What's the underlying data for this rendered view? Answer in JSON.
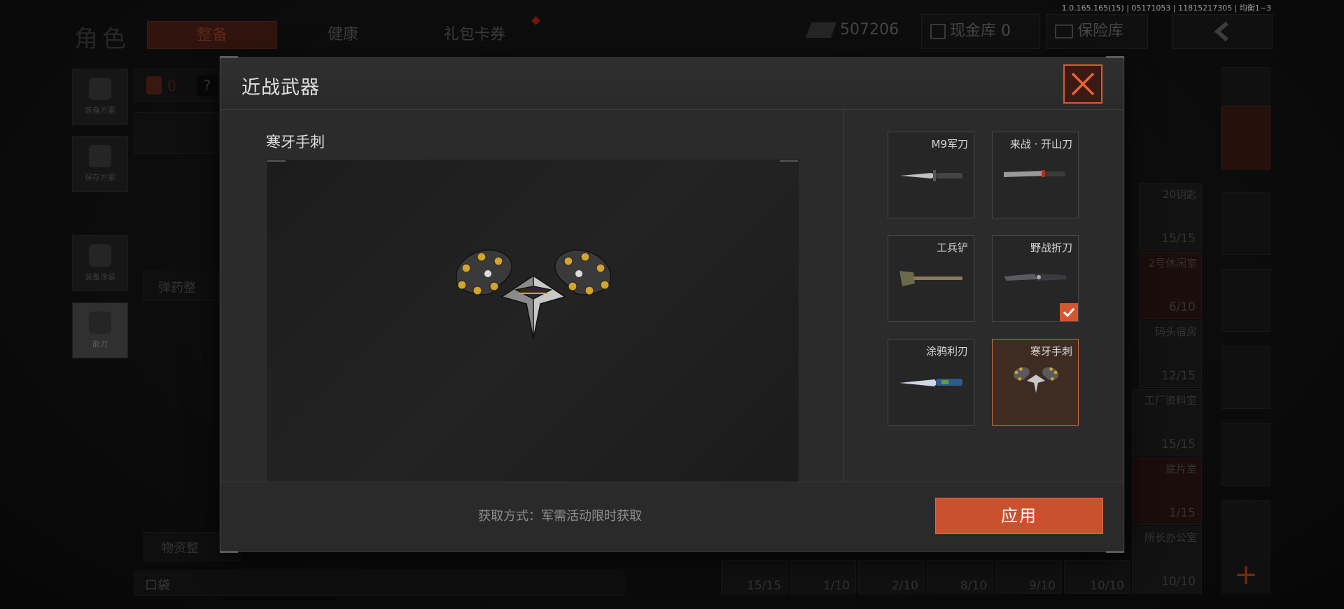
{
  "version": "1.0.165.165(15) | 05171053 | 11815217305 | 均衡1~3",
  "background": {
    "page_title": "角色",
    "tabs": [
      {
        "label": "整备",
        "active": true
      },
      {
        "label": "健康",
        "active": false
      },
      {
        "label": "礼包卡券",
        "active": false
      }
    ],
    "currency": "507206",
    "cash_vault_label": "现金库 0",
    "safe_label": "保险库",
    "armor_count": "0",
    "help_symbol": "?",
    "left_nav": [
      {
        "label": "装备方案",
        "icon": "vest-icon"
      },
      {
        "label": "保存方案",
        "icon": "download-icon"
      },
      {
        "label": "装备涂装",
        "icon": "helmet-icon"
      },
      {
        "label": "能力",
        "icon": "ability-icon"
      }
    ],
    "ammo_section": "弹药整",
    "supplies_section": "物资整",
    "pocket_label": "口袋",
    "keys": [
      {
        "label": "20钥匙",
        "count": "15/15"
      },
      {
        "label": "2号休闲室",
        "count": "6/10"
      },
      {
        "label": "码头宿房",
        "count": "12/15"
      },
      {
        "label": "工厂资料室",
        "count": "15/15"
      },
      {
        "label": "底片室",
        "count": "1/15"
      },
      {
        "label": "所长办公室",
        "count": "10/10"
      }
    ],
    "bottom_counts": [
      "15/15",
      "1/10",
      "2/10",
      "8/10",
      "9/10",
      "10/10",
      "10/10"
    ],
    "add_symbol": "+"
  },
  "modal": {
    "title": "近战武器",
    "selected_weapon_name": "寒牙手刺",
    "acquire_text": "获取方式：军需活动限时获取",
    "apply_label": "应用",
    "weapons": [
      {
        "name": "M9军刀",
        "icon": "bayonet-knife-icon",
        "equipped": false,
        "selected": false
      },
      {
        "name": "来战 · 开山刀",
        "icon": "machete-icon",
        "equipped": false,
        "selected": false
      },
      {
        "name": "工兵铲",
        "icon": "shovel-icon",
        "equipped": false,
        "selected": false
      },
      {
        "name": "野战折刀",
        "icon": "folding-knife-icon",
        "equipped": true,
        "selected": false
      },
      {
        "name": "涂鸦利刃",
        "icon": "graffiti-blade-icon",
        "equipped": false,
        "selected": false
      },
      {
        "name": "寒牙手刺",
        "icon": "knuckle-dagger-icon",
        "equipped": false,
        "selected": true
      }
    ]
  },
  "colors": {
    "accent": "#c9512e",
    "close_border": "#d85a30",
    "panel": "#2b2b2b"
  }
}
